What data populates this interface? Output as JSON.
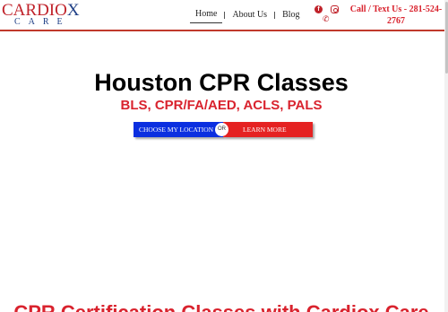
{
  "logo": {
    "top_part1": "CARDI",
    "top_part2": "O",
    "top_x": "X",
    "bottom": "CARE"
  },
  "nav": {
    "items": [
      {
        "label": "Home",
        "active": true
      },
      {
        "label": "About Us",
        "active": false
      },
      {
        "label": "Blog",
        "active": false
      }
    ]
  },
  "social": {
    "facebook_glyph": "f",
    "phone_glyph": "✆"
  },
  "contact": {
    "call_text": "Call / Text Us - 281-524-2767"
  },
  "hero": {
    "title": "Houston CPR Classes",
    "subtitle": "BLS, CPR/FA/AED, ACLS, PALS",
    "cta_location": "CHOOSE MY LOCATION",
    "cta_or": "OR",
    "cta_learn": "LEARN MORE"
  },
  "section": {
    "heading": "CPR Certification Classes with Cardiox Care"
  },
  "colors": {
    "brand_red": "#d9232e",
    "brand_blue": "#0b2fe0",
    "logo_navy": "#1f3f86"
  }
}
